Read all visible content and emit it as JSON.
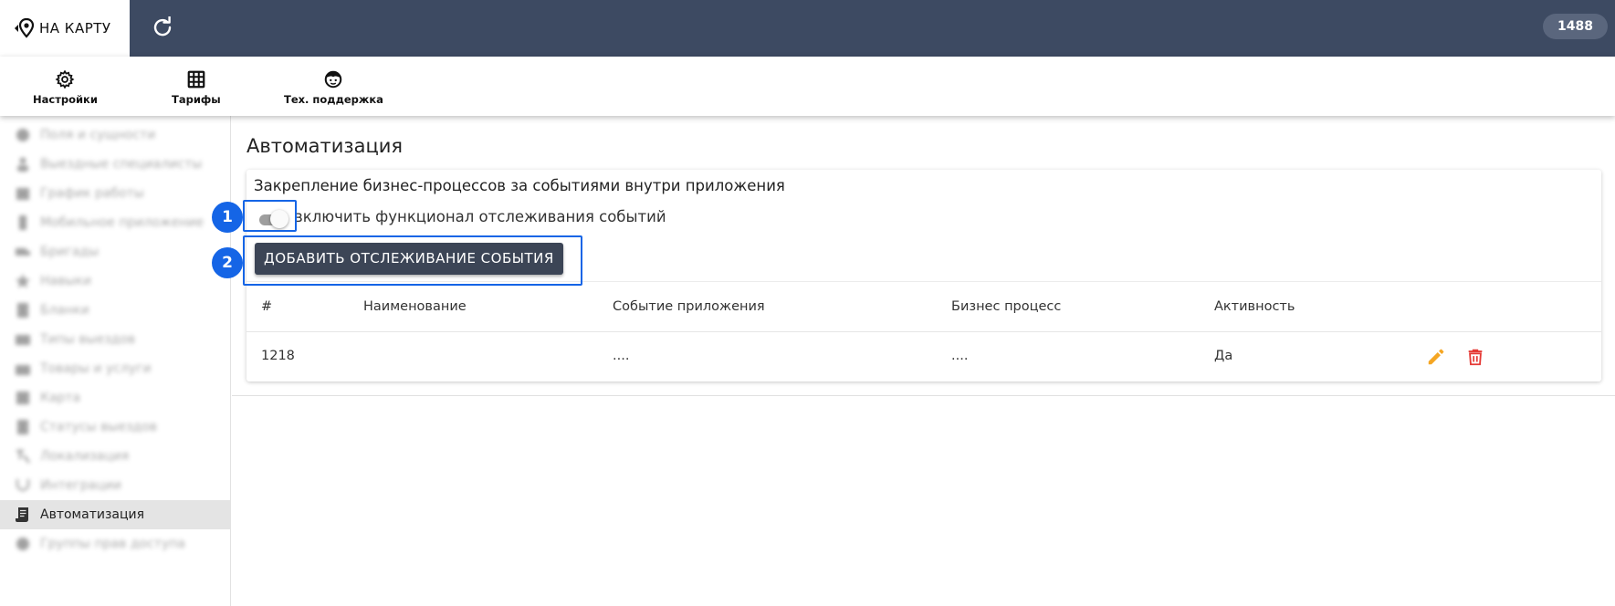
{
  "header": {
    "logo_text": "НА КАРТУ",
    "user_id": "1488",
    "background_color": "#3d4a62"
  },
  "menu": {
    "items": [
      {
        "label": "Настройки",
        "icon": "gear-icon"
      },
      {
        "label": "Тарифы",
        "icon": "table-grid-icon"
      },
      {
        "label": "Тех. поддержка",
        "icon": "support-face-icon"
      }
    ]
  },
  "sidebar": {
    "items": [
      {
        "label": "Поля и сущности",
        "icon": "gear-icon"
      },
      {
        "label": "Выездные специалисты",
        "icon": "person-icon"
      },
      {
        "label": "График работы",
        "icon": "calendar-icon"
      },
      {
        "label": "Мобильное приложение",
        "icon": "phone-icon"
      },
      {
        "label": "Бригады",
        "icon": "truck-icon"
      },
      {
        "label": "Навыки",
        "icon": "star-icon"
      },
      {
        "label": "Бланки",
        "icon": "document-icon"
      },
      {
        "label": "Типы выездов",
        "icon": "clipboard-icon"
      },
      {
        "label": "Товары и услуги",
        "icon": "briefcase-icon"
      },
      {
        "label": "Карта",
        "icon": "map-icon"
      },
      {
        "label": "Статусы выездов",
        "icon": "status-icon"
      },
      {
        "label": "Локализация",
        "icon": "translate-icon"
      },
      {
        "label": "Интеграции",
        "icon": "plug-icon"
      },
      {
        "label": "Автоматизация",
        "icon": "script-icon",
        "active": true
      },
      {
        "label": "Группы прав доступа",
        "icon": "lock-icon"
      }
    ]
  },
  "main": {
    "title": "Автоматизация",
    "card": {
      "heading": "Закрепление бизнес-процессов за событиями внутри приложения",
      "toggle_label": "включить функционал отслеживания событий",
      "toggle_on": false,
      "add_button_label": "ДОБАВИТЬ ОТСЛЕЖИВАНИЕ СОБЫТИЯ"
    },
    "table": {
      "columns": [
        "#",
        "Наименование",
        "Событие приложения",
        "Бизнес процесс",
        "Активность"
      ],
      "rows": [
        {
          "id": "1218",
          "name": "",
          "event": "....",
          "process": "....",
          "active": "Да"
        }
      ]
    }
  },
  "annotations": {
    "marker_1": "1",
    "marker_2": "2",
    "color": "#1565e6"
  },
  "colors": {
    "edit_icon": "#f5a623",
    "delete_icon": "#e53935",
    "button": "#3c4556"
  }
}
